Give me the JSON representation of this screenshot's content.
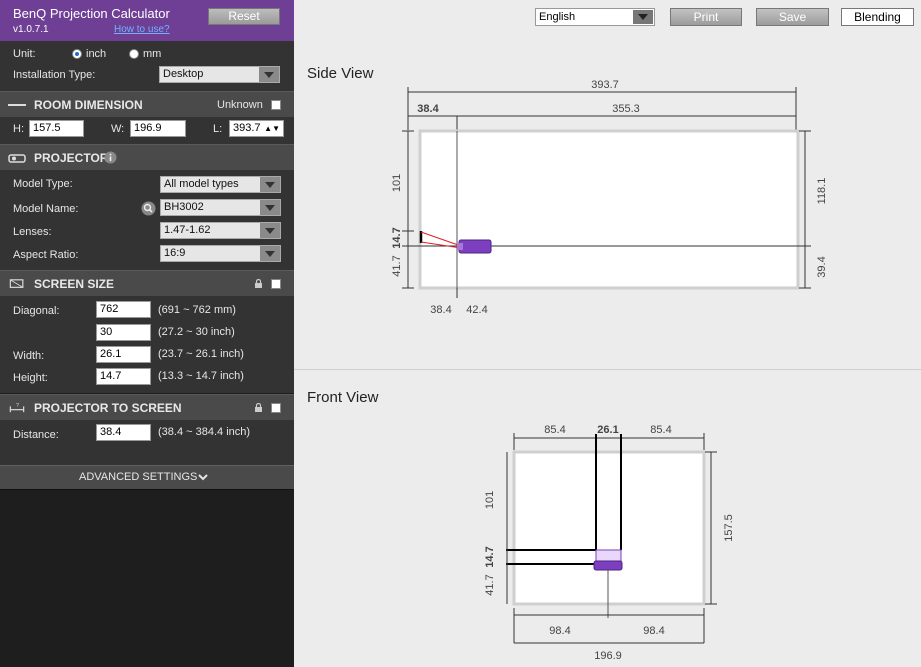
{
  "app": {
    "title": "BenQ Projection Calculator",
    "version": "v1.0.7.1",
    "how_to_use": "How to use?",
    "reset_label": "Reset"
  },
  "general": {
    "unit_label": "Unit:",
    "unit_inch": "inch",
    "unit_mm": "mm",
    "unit_selected": "inch",
    "installation_label": "Installation Type:",
    "installation_value": "Desktop"
  },
  "room": {
    "title": "ROOM DIMENSION",
    "unknown_label": "Unknown",
    "h_label": "H:",
    "h_value": "157.5",
    "w_label": "W:",
    "w_value": "196.9",
    "l_label": "L:",
    "l_value": "393.7"
  },
  "projector": {
    "title": "PROJECTOR",
    "model_type_label": "Model Type:",
    "model_type_value": "All model types",
    "model_name_label": "Model Name:",
    "model_name_value": "BH3002",
    "lenses_label": "Lenses:",
    "lenses_value": "1.47-1.62",
    "aspect_label": "Aspect Ratio:",
    "aspect_value": "16:9"
  },
  "screen": {
    "title": "SCREEN SIZE",
    "diagonal_label": "Diagonal:",
    "diagonal_mm": "762",
    "diagonal_mm_range": "(691 ~ 762 mm)",
    "diagonal_inch": "30",
    "diagonal_inch_range": "(27.2 ~ 30 inch)",
    "width_label": "Width:",
    "width_value": "26.1",
    "width_range": "(23.7 ~ 26.1 inch)",
    "height_label": "Height:",
    "height_value": "14.7",
    "height_range": "(13.3 ~ 14.7 inch)"
  },
  "throw": {
    "title": "PROJECTOR TO SCREEN",
    "distance_label": "Distance:",
    "distance_value": "38.4",
    "distance_range": "(38.4 ~ 384.4 inch)"
  },
  "advanced": {
    "label": "ADVANCED SETTINGS"
  },
  "toolbar": {
    "language": "English",
    "print": "Print",
    "save": "Save",
    "blending": "Blending"
  },
  "side_view": {
    "title": "Side View",
    "total_length": "393.7",
    "throw_distance": "38.4",
    "remaining_length": "355.3",
    "upper_height": "101",
    "screen_height": "14.7",
    "lower_height": "41.7",
    "right_upper": "118.1",
    "right_lower": "39.4",
    "bottom_left": "38.4",
    "bottom_right": "42.4"
  },
  "front_view": {
    "title": "Front View",
    "top_left": "85.4",
    "top_center": "26.1",
    "top_right": "85.4",
    "upper_height": "101",
    "screen_height": "14.7",
    "lower_height": "41.7",
    "right_height": "157.5",
    "bottom_left": "98.4",
    "bottom_right": "98.4",
    "total_width": "196.9"
  },
  "colors": {
    "header_purple": "#6f3f96",
    "projector_purple": "#7b3fbf",
    "link_blue": "#6fb3ff"
  }
}
